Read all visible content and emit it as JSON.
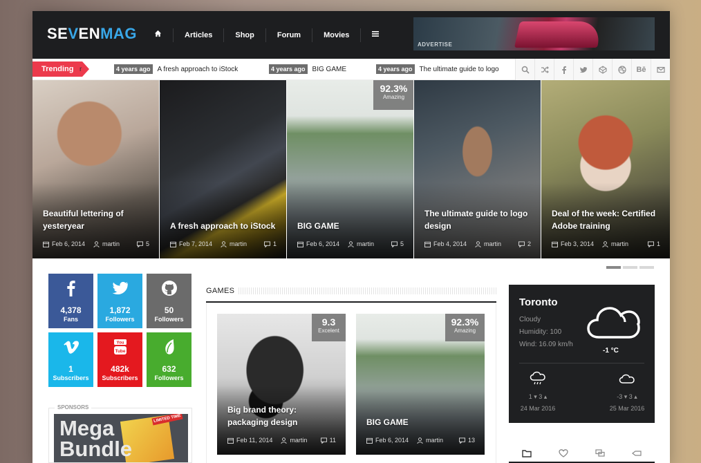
{
  "header": {
    "logo_left": "SE",
    "logo_accent": "V",
    "logo_mid": "EN",
    "logo_right": "MAG",
    "nav": [
      "Articles",
      "Shop",
      "Forum",
      "Movies"
    ],
    "ad_label": "ADVERTISE"
  },
  "trending": {
    "label": "Trending",
    "cut_text": "r",
    "items": [
      {
        "age": "4 years ago",
        "title": "A fresh approach to iStock"
      },
      {
        "age": "4 years ago",
        "title": "BIG GAME"
      },
      {
        "age": "4 years ago",
        "title": "The ultimate guide to logo"
      }
    ],
    "icons": [
      "search-icon",
      "shuffle-icon",
      "facebook-icon",
      "twitter-icon",
      "codepen-icon",
      "dribbble-icon",
      "behance-icon",
      "mail-icon"
    ],
    "behance_text": "Bē"
  },
  "slides": [
    {
      "title": "Beautiful lettering of yesteryear",
      "date": "Feb 6, 2014",
      "author": "martin",
      "comments": "5"
    },
    {
      "title": "A fresh approach to iStock",
      "date": "Feb 7, 2014",
      "author": "martin",
      "comments": "1"
    },
    {
      "title": "BIG GAME",
      "date": "Feb 6, 2014",
      "author": "martin",
      "comments": "5",
      "score": "92.3%",
      "score_label": "Amazing"
    },
    {
      "title": "The ultimate guide to logo design",
      "date": "Feb 4, 2014",
      "author": "martin",
      "comments": "2"
    },
    {
      "title": "Deal of the week: Certified Adobe training",
      "date": "Feb 3, 2014",
      "author": "martin",
      "comments": "1"
    }
  ],
  "social": [
    {
      "network": "facebook",
      "icon": "facebook-icon",
      "count": "4,378",
      "label": "Fans",
      "color": "#3b5998"
    },
    {
      "network": "twitter",
      "icon": "twitter-icon",
      "count": "1,872",
      "label": "Followers",
      "color": "#2aa9e0"
    },
    {
      "network": "github",
      "icon": "github-icon",
      "count": "50",
      "label": "Followers",
      "color": "#6b6b6b"
    },
    {
      "network": "vimeo",
      "icon": "vimeo-icon",
      "count": "1",
      "label": "Subscribers",
      "color": "#1ab7ea"
    },
    {
      "network": "youtube",
      "icon": "youtube-icon",
      "count": "482k",
      "label": "Subscribers",
      "color": "#e4191f"
    },
    {
      "network": "envato",
      "icon": "envato-icon",
      "count": "632",
      "label": "Followers",
      "color": "#48ac2e"
    }
  ],
  "sponsors": {
    "title": "SPONSORS",
    "banner_text_1": "Mega",
    "banner_text_2": "Bundle",
    "banner_tag": "LIMITED TIME"
  },
  "games": {
    "title": "GAMES",
    "cards": [
      {
        "title": "Big brand theory: packaging design",
        "date": "Feb 11, 2014",
        "author": "martin",
        "comments": "11",
        "score": "9.3",
        "score_label": "Excelent"
      },
      {
        "title": "BIG GAME",
        "date": "Feb 6, 2014",
        "author": "martin",
        "comments": "13",
        "score": "92.3%",
        "score_label": "Amazing"
      }
    ]
  },
  "weather": {
    "city": "Toronto",
    "condition": "Cloudy",
    "humidity": "Humidity: 100",
    "wind": "Wind: 16.09 km/h",
    "temp": "-1 °C",
    "forecast": [
      {
        "temps": "1 ▾ 3 ▴",
        "date": "24 Mar 2016",
        "icon": "rain-cloud-icon"
      },
      {
        "temps": "-3 ▾ 3 ▴",
        "date": "25 Mar 2016",
        "icon": "cloud-icon"
      }
    ]
  },
  "colors": {
    "accent": "#39a7e8",
    "trending": "#ec3a4c",
    "header_bg": "#1d1e20"
  }
}
